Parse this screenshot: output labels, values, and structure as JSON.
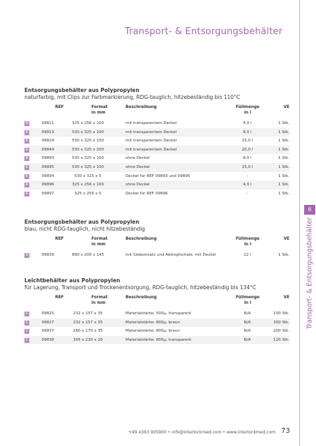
{
  "header": {
    "title": "Transport- & Entsorgungsbehälter"
  },
  "side": {
    "tab_number": "6",
    "title": "Transport- & Entsorgungsbehälter"
  },
  "columns": {
    "ref": "REF",
    "format": "Format\nin mm",
    "desc": "Beschreibung",
    "fill": "Füllmenge\nin l",
    "ve": "VE"
  },
  "sections": [
    {
      "title": "Entsorgungsbehälter aus Polypropylen",
      "subtitle": "naturfarbig, mit Clips zur Farbmarkierung, RDG-tauglich, hitzebeständig bis 110°C",
      "badge": "A",
      "rows": [
        [
          "09811",
          "325 x 256 x 100",
          "mit transparentem Deckel",
          "4,0 l",
          "1 Stk."
        ],
        [
          "09813",
          "530 x 325 x 100",
          "mit transparentem Deckel",
          "8,0 l",
          "1 Stk."
        ],
        [
          "09824",
          "530 x 325 x 150",
          "mit transparentem Deckel",
          "15,0 l",
          "1 Stk."
        ],
        [
          "09844",
          "530 x 325 x 200",
          "mit transparentem Deckel",
          "20,0 l",
          "1 Stk."
        ],
        [
          "09893",
          "530 x 325 x 100",
          "ohne Deckel",
          "8,0 l",
          "1 Stk."
        ],
        [
          "09895",
          "530 x 325 x 150",
          "ohne Deckel",
          "15,0 l",
          "1 Stk."
        ],
        [
          "09894",
          "530 x 325 x 5",
          "Deckel für REF 09893 und 09895",
          "-",
          "1 Stk."
        ],
        [
          "09896",
          "325 x 256 x 100",
          "ohne Deckel",
          "4,0 l",
          "1 Stk."
        ],
        [
          "09897",
          "325 x 256 x 5",
          "Deckel für REF 09896",
          "-",
          "1 Stk."
        ]
      ]
    },
    {
      "title": "Entsorgungsbehälter aus Polypropylen",
      "subtitle": "blau, nicht RDG-tauglich, nicht hitzebeständig",
      "badge": "B",
      "rows": [
        [
          "09839",
          "890 x 200 x 145",
          "mit Siebeinsatz und Abtropfschale, mit Deckel",
          "12 l",
          "1 Stk."
        ]
      ]
    },
    {
      "title": "Leichtbehälter aus Polypropylen",
      "subtitle": "für Lagerung, Transport und Trockenentsorgung, RDG-tauglich, hitzebeständig bis 134°C",
      "badge": "C",
      "rows": [
        [
          "09825",
          "232 x 157 x 35",
          "Materialstärke: 500µ, transparent",
          "N/A",
          "100 Stk."
        ],
        [
          "09827",
          "232 x 157 x 35",
          "Materialstärke: 800µ, braun",
          "N/A",
          "350 Stk."
        ],
        [
          "09837",
          "260 x 170 x 35",
          "Materialstärke: 800µ, braun",
          "N/A",
          "200 Stk."
        ],
        [
          "09838",
          "305 x 230 x 20",
          "Materialstärke: 800µ, transparent",
          "N/A",
          "120 Stk."
        ]
      ]
    }
  ],
  "footer": {
    "text": "+49 4363 905900  •  info@interlockmed.com  •  www.interlockmed.com",
    "page": "73"
  }
}
